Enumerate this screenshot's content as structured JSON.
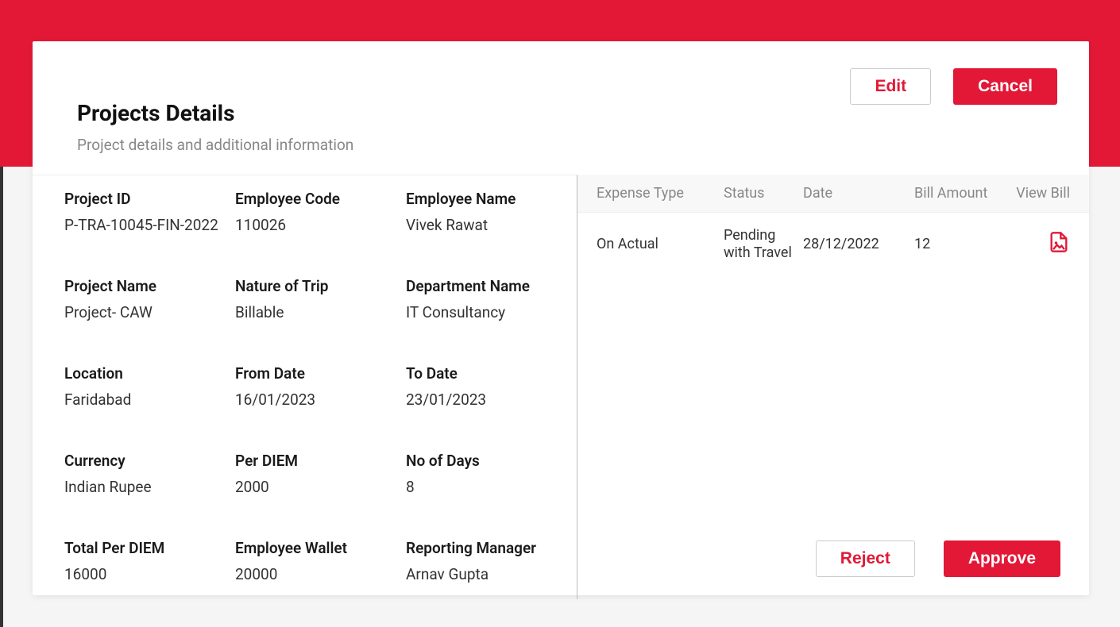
{
  "header": {
    "title": "Projects Details",
    "subtitle": "Project details and additional information",
    "edit_label": "Edit",
    "cancel_label": "Cancel"
  },
  "fields": {
    "project_id": {
      "label": "Project ID",
      "value": "P-TRA-10045-FIN-2022"
    },
    "employee_code": {
      "label": "Employee Code",
      "value": "110026"
    },
    "employee_name": {
      "label": "Employee Name",
      "value": "Vivek Rawat"
    },
    "project_name": {
      "label": "Project Name",
      "value": "Project- CAW"
    },
    "nature_of_trip": {
      "label": "Nature of Trip",
      "value": "Billable"
    },
    "department_name": {
      "label": "Department Name",
      "value": "IT Consultancy"
    },
    "location": {
      "label": "Location",
      "value": "Faridabad"
    },
    "from_date": {
      "label": "From Date",
      "value": "16/01/2023"
    },
    "to_date": {
      "label": "To Date",
      "value": "23/01/2023"
    },
    "currency": {
      "label": "Currency",
      "value": "Indian Rupee"
    },
    "per_diem": {
      "label": "Per DIEM",
      "value": "2000"
    },
    "no_of_days": {
      "label": "No of Days",
      "value": "8"
    },
    "total_per_diem": {
      "label": "Total Per DIEM",
      "value": "16000"
    },
    "employee_wallet": {
      "label": "Employee Wallet",
      "value": "20000"
    },
    "reporting_manager": {
      "label": "Reporting Manager",
      "value": "Arnav Gupta"
    }
  },
  "table": {
    "headers": {
      "expense_type": "Expense Type",
      "status": "Status",
      "date": "Date",
      "bill_amount": "Bill Amount",
      "view_bill": "View Bill"
    },
    "rows": [
      {
        "expense_type": "On Actual",
        "status": "Pending with Travel",
        "date": "28/12/2022",
        "bill_amount": "12"
      }
    ]
  },
  "footer": {
    "reject_label": "Reject",
    "approve_label": "Approve"
  }
}
